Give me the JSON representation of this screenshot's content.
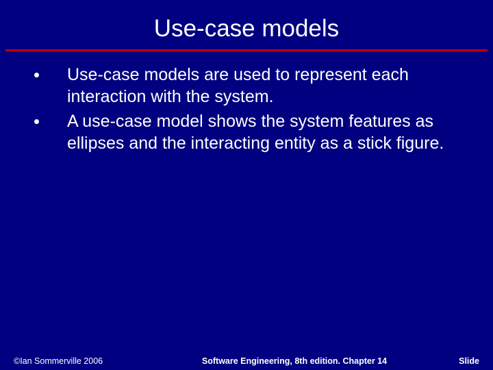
{
  "title": "Use-case models",
  "bullets": [
    "Use-case models are used to represent each interaction with the system.",
    "A use-case model shows the system features as ellipses and the interacting entity as a stick figure."
  ],
  "footer": {
    "left": "©Ian Sommerville 2006",
    "center": "Software Engineering, 8th edition. Chapter 14",
    "right": "Slide"
  }
}
